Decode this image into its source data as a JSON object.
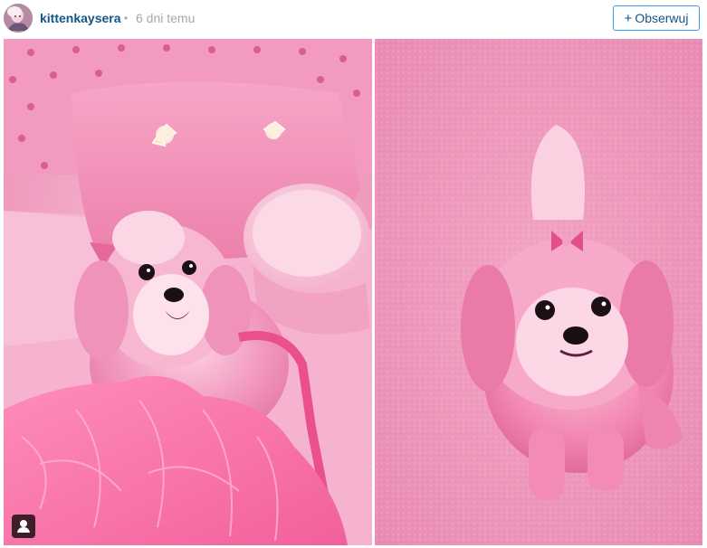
{
  "header": {
    "username": "kittenkaysera",
    "separator": "•",
    "time": "6 dni temu",
    "follow_plus": "+",
    "follow_label": "Obserwuj"
  },
  "icons": {
    "avatar": "profile-avatar",
    "user_tag": "user-tag-icon"
  },
  "colors": {
    "username": "#125688",
    "follow_border": "#3897f0",
    "meta_text": "#a5a7aa",
    "photo_pink": "#f3a9c8"
  }
}
